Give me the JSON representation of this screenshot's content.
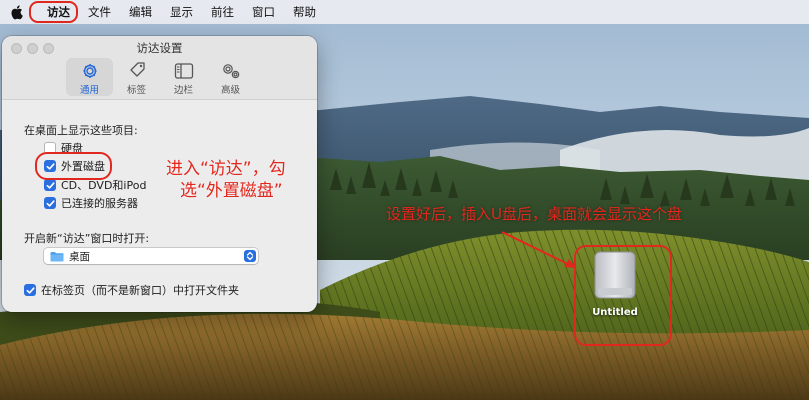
{
  "menubar": {
    "apple_icon": "apple-logo-icon",
    "items": [
      "访达",
      "文件",
      "编辑",
      "显示",
      "前往",
      "窗口",
      "帮助"
    ]
  },
  "window": {
    "title": "访达设置",
    "tabs": [
      {
        "label": "通用",
        "icon": "gear-icon",
        "selected": true
      },
      {
        "label": "标签",
        "icon": "tag-icon",
        "selected": false
      },
      {
        "label": "边栏",
        "icon": "sidebar-icon",
        "selected": false
      },
      {
        "label": "高级",
        "icon": "gears-icon",
        "selected": false
      }
    ],
    "desktop_section_label": "在桌面上显示这些项目:",
    "desktop_items": [
      {
        "label": "硬盘",
        "checked": false
      },
      {
        "label": "外置磁盘",
        "checked": true
      },
      {
        "label": "CD、DVD和iPod",
        "checked": true
      },
      {
        "label": "已连接的服务器",
        "checked": true
      }
    ],
    "new_window_label": "开启新“访达”窗口时打开:",
    "new_window_value": "桌面",
    "tabs_option": {
      "label": "在标签页（而不是新窗口）中打开文件夹",
      "checked": true
    }
  },
  "annotations": {
    "step1_line1": "进入“访达”，勾",
    "step1_line2": "选“外置磁盘”",
    "step2": "设置好后，插入U盘后，桌面就会显示这个盘",
    "color": "#e3271d"
  },
  "desktop": {
    "drive_label": "Untitled",
    "drive_icon": "external-drive-icon"
  },
  "colors": {
    "accent": "#2a6fe0",
    "highlight": "#e1281f"
  }
}
